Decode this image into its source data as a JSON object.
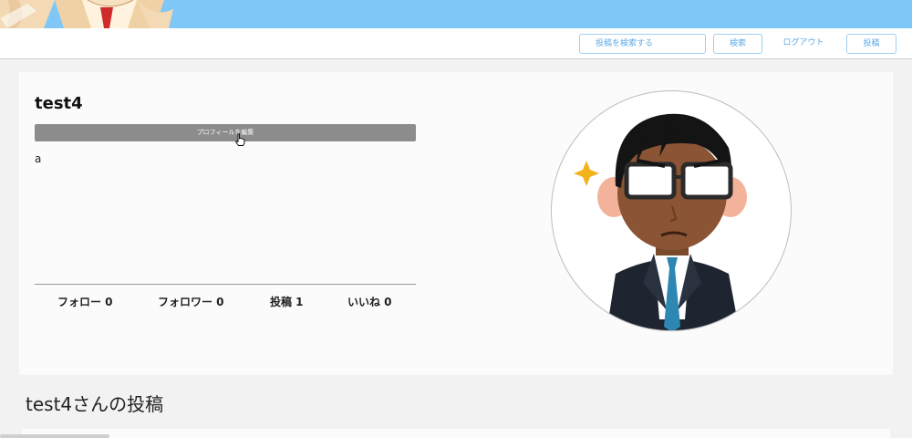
{
  "header": {
    "search": {
      "placeholder": "投稿を検索する",
      "value": ""
    },
    "search_button": "検索",
    "logout_link": "ログアウト",
    "post_button": "投稿"
  },
  "profile": {
    "username": "test4",
    "edit_button": "プロフィールを編集",
    "bio": "a",
    "stats": {
      "following": "フォロー 0",
      "followers": "フォロワー 0",
      "posts": "投稿 1",
      "likes": "いいね 0"
    }
  },
  "posts_section": {
    "title": "test4さんの投稿"
  },
  "colors": {
    "banner": "#7fc7f6",
    "accent": "#5ba9e6",
    "edit_button_bg": "#8c8c8c"
  },
  "icons": {
    "avatar": "businessman-illustration",
    "cursor": "hand-pointer-icon",
    "banner_art": "anime-character-illustration"
  }
}
